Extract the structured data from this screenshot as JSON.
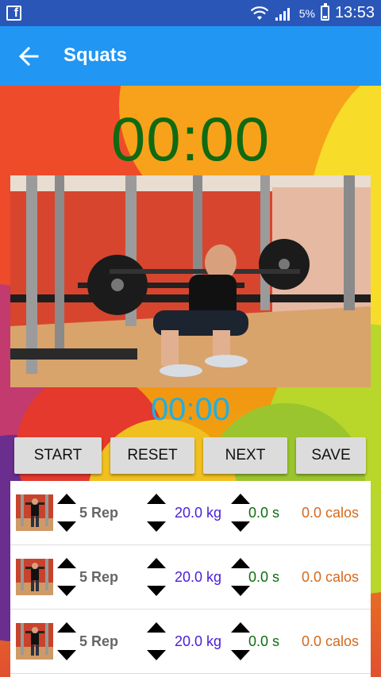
{
  "status_bar": {
    "app_icon": "facebook-icon",
    "battery_percent": "5%",
    "time": "13:53"
  },
  "app_bar": {
    "back_icon": "arrow-left-icon",
    "title": "Squats"
  },
  "timers": {
    "main": "00:00",
    "sub": "00:00"
  },
  "buttons": {
    "start": "START",
    "reset": "RESET",
    "next": "NEXT",
    "save": "SAVE"
  },
  "sets": [
    {
      "reps": "5 Rep",
      "weight": "20.0 kg",
      "duration": "0.0 s",
      "calories": "0.0 calos"
    },
    {
      "reps": "5 Rep",
      "weight": "20.0 kg",
      "duration": "0.0 s",
      "calories": "0.0 calos"
    },
    {
      "reps": "5 Rep",
      "weight": "20.0 kg",
      "duration": "0.0 s",
      "calories": "0.0 calos"
    }
  ],
  "colors": {
    "status_bar": "#2a56b8",
    "app_bar": "#2196f3",
    "main_timer": "#0f6a12",
    "sub_timer": "#22aee0",
    "weight_text": "#4a20d8",
    "duration_text": "#0b6e0b",
    "calories_text": "#d2691e"
  }
}
